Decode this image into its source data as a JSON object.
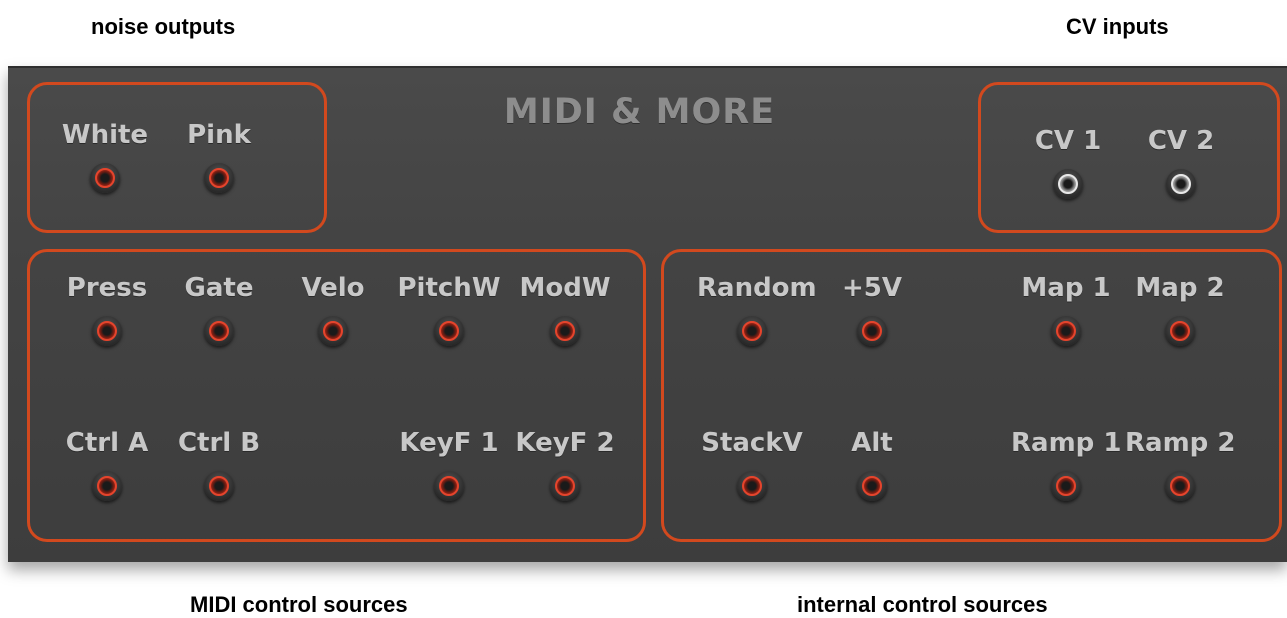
{
  "captions": {
    "noise_outputs": "noise outputs",
    "cv_inputs": "CV inputs",
    "midi_sources": "MIDI control sources",
    "internal_sources": "internal control sources"
  },
  "panel": {
    "title": "MIDI & MORE"
  },
  "colors": {
    "group_outline": "#d2491e",
    "output_jack_ring": "#e5442c",
    "input_jack_ring": "#e8e8e8",
    "label_text": "#c8c8c8",
    "title_text": "#8d8d8d"
  },
  "noise": {
    "white": "White",
    "pink": "Pink"
  },
  "cv": {
    "cv1": "CV 1",
    "cv2": "CV 2"
  },
  "midi": {
    "press": "Press",
    "gate": "Gate",
    "velo": "Velo",
    "pitchw": "PitchW",
    "modw": "ModW",
    "ctrl_a": "Ctrl A",
    "ctrl_b": "Ctrl B",
    "keyf1": "KeyF 1",
    "keyf2": "KeyF 2"
  },
  "internal": {
    "random": "Random",
    "plus5v": "+5V",
    "map1": "Map 1",
    "map2": "Map 2",
    "stackv": "StackV",
    "alt": "Alt",
    "ramp1": "Ramp 1",
    "ramp2": "Ramp 2"
  }
}
